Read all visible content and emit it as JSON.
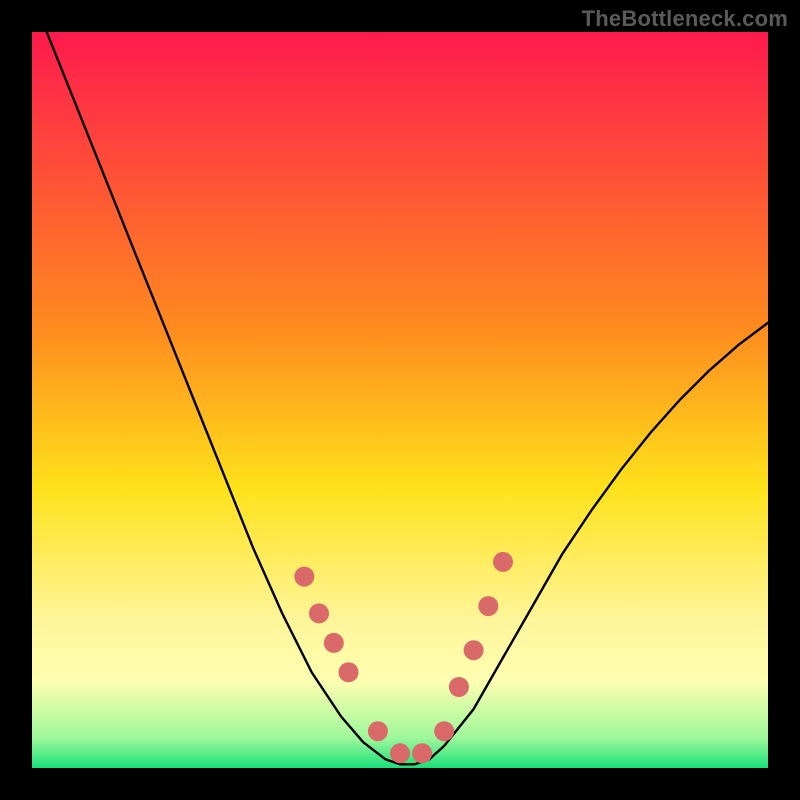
{
  "watermark": "TheBottleneck.com",
  "chart_data": {
    "type": "line",
    "title": "",
    "xlabel": "",
    "ylabel": "",
    "xlim": [
      0,
      100
    ],
    "ylim": [
      0,
      100
    ],
    "grid": false,
    "background_gradient_stops": [
      {
        "pos": 0.0,
        "color": "#ff1a4d"
      },
      {
        "pos": 0.4,
        "color": "#ff8a1f"
      },
      {
        "pos": 0.62,
        "color": "#ffe21a"
      },
      {
        "pos": 0.8,
        "color": "#fff59a"
      },
      {
        "pos": 0.88,
        "color": "#ffffb0"
      },
      {
        "pos": 0.96,
        "color": "#9df79a"
      },
      {
        "pos": 1.0,
        "color": "#19e07a"
      }
    ],
    "series": [
      {
        "name": "bottleneck-curve",
        "stroke": "#000000",
        "stroke_width": 2.4,
        "x": [
          2,
          6,
          10,
          14,
          18,
          22,
          26,
          30,
          34,
          38,
          42,
          45,
          48,
          50,
          52,
          54,
          56,
          60,
          64,
          68,
          72,
          76,
          80,
          84,
          88,
          92,
          96,
          100
        ],
        "y": [
          100,
          90,
          80,
          70,
          60,
          50,
          40,
          30,
          21,
          13,
          7,
          3.5,
          1.2,
          0.5,
          0.5,
          1.2,
          3,
          8,
          15,
          22,
          29,
          35,
          40.5,
          45.5,
          50,
          54,
          57.5,
          60.5
        ]
      }
    ],
    "markers": {
      "name": "data-markers",
      "color": "#da6a6a",
      "radius_px": 10,
      "x": [
        37,
        39,
        41,
        43,
        47,
        50,
        53,
        56,
        58,
        60,
        62,
        64
      ],
      "y": [
        26,
        21,
        17,
        13,
        5,
        2,
        2,
        5,
        11,
        16,
        22,
        28
      ]
    }
  }
}
